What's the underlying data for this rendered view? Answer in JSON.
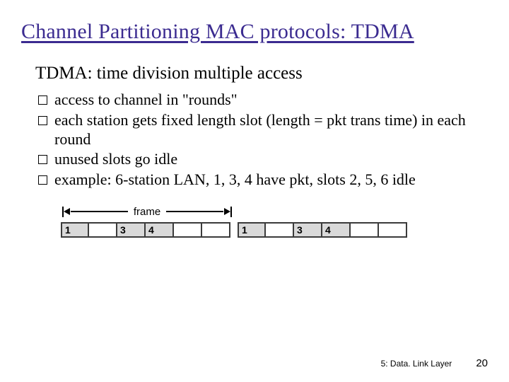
{
  "title": "Channel Partitioning MAC protocols: TDMA",
  "subtitle": "TDMA: time division multiple access",
  "bullets": [
    "access to channel in \"rounds\"",
    "each station gets fixed length slot (length = pkt trans time) in each round",
    "unused slots go idle",
    "example: 6-station LAN, 1, 3, 4 have pkt, slots 2, 5, 6 idle"
  ],
  "figure": {
    "frame_label": "frame",
    "frames": [
      {
        "slots": [
          {
            "label": "1",
            "state": "filled"
          },
          {
            "label": "",
            "state": "idle"
          },
          {
            "label": "3",
            "state": "filled"
          },
          {
            "label": "4",
            "state": "filled"
          },
          {
            "label": "",
            "state": "idle"
          },
          {
            "label": "",
            "state": "idle"
          }
        ]
      },
      {
        "slots": [
          {
            "label": "1",
            "state": "filled"
          },
          {
            "label": "",
            "state": "idle"
          },
          {
            "label": "3",
            "state": "filled"
          },
          {
            "label": "4",
            "state": "filled"
          },
          {
            "label": "",
            "state": "idle"
          },
          {
            "label": "",
            "state": "idle"
          }
        ]
      }
    ]
  },
  "footer": {
    "chapter": "5: Data. Link Layer",
    "page": "20"
  }
}
